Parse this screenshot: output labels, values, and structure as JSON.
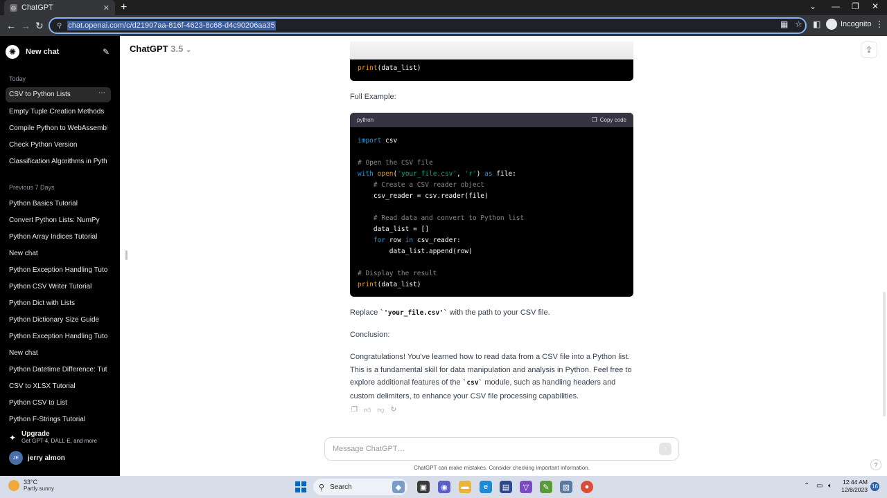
{
  "browser": {
    "tab_title": "ChatGPT",
    "url": "chat.openai.com/c/d21907aa-816f-4623-8c68-d4c90206aa35",
    "incognito_label": "Incognito"
  },
  "sidebar": {
    "new_chat_label": "New chat",
    "today_label": "Today",
    "today_items": [
      "CSV to Python Lists",
      "Empty Tuple Creation Methods",
      "Compile Python to WebAssembly",
      "Check Python Version",
      "Classification Algorithms in Pytho"
    ],
    "prev7_label": "Previous 7 Days",
    "prev7_items": [
      "Python Basics Tutorial",
      "Convert Python Lists: NumPy",
      "Python Array Indices Tutorial",
      "New chat",
      "Python Exception Handling Tutori",
      "Python CSV Writer Tutorial",
      "Python Dict with Lists",
      "Python Dictionary Size Guide",
      "Python Exception Handling Tutori",
      "New chat",
      "Python Datetime Difference: Tuto",
      "CSV to XLSX Tutorial",
      "Python CSV to List",
      "Python F-Strings Tutorial"
    ],
    "upgrade_title": "Upgrade",
    "upgrade_sub": "Get GPT-4, DALL·E, and more",
    "user_initials": "JE",
    "user_name": "jerry almon"
  },
  "header": {
    "model_name": "ChatGPT",
    "model_version": "3.5"
  },
  "chat": {
    "top_code_line": "print(data_list)",
    "full_example_label": "Full Example:",
    "code_lang": "python",
    "copy_label": "Copy code",
    "replace_pre": "Replace ",
    "replace_code": "`'your_file.csv'`",
    "replace_post": " with the path to your CSV file.",
    "conclusion_label": "Conclusion:",
    "conclusion_pre": "Congratulations! You've learned how to read data from a CSV file into a Python list. This is a fundamental skill for data manipulation and analysis in Python. Feel free to explore additional features of the ",
    "conclusion_code": "`csv`",
    "conclusion_post": " module, such as handling headers and custom delimiters, to enhance your CSV file processing capabilities."
  },
  "code": {
    "l1_kw": "import",
    "l1_rest": " csv",
    "l3": "# Open the CSV file",
    "l4_kw": "with",
    "l4_fn": "open",
    "l4_s1": "'your_file.csv'",
    "l4_s2": "'r'",
    "l4_as": "as",
    "l4_rest": " file:",
    "l5": "    # Create a CSV reader object",
    "l6": "    csv_reader = csv.reader(file)",
    "l8": "    # Read data and convert to Python list",
    "l9": "    data_list = []",
    "l10_kw": "for",
    "l10_in": "in",
    "l10_a": " row ",
    "l10_b": " csv_reader:",
    "l11": "        data_list.append(row)",
    "l13": "# Display the result",
    "l14_fn": "print",
    "l14_rest": "(data_list)"
  },
  "composer": {
    "placeholder": "Message ChatGPT…",
    "disclaimer": "ChatGPT can make mistakes. Consider checking important information."
  },
  "taskbar": {
    "temp": "33°C",
    "weather": "Partly sunny",
    "search_label": "Search",
    "time": "12:44 AM",
    "date": "12/8/2023",
    "notif_count": "16"
  }
}
